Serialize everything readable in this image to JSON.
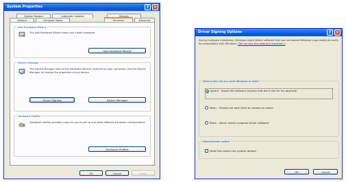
{
  "system_properties": {
    "title": "System Properties",
    "tabs_row1": [
      "System Restore",
      "Automatic Updates",
      "Remote"
    ],
    "tabs_row2": [
      "General",
      "Computer Name",
      "Hardware",
      "Advanced"
    ],
    "add_hardware": {
      "label": "Add Hardware Wizard",
      "text": "The Add Hardware Wizard helps you install hardware.",
      "button": "Add Hardware Wizard"
    },
    "device_manager": {
      "label": "Device Manager",
      "text": "The Device Manager lists all the hardware devices installed on your computer. Use the Device Manager to change the properties of any device.",
      "button_signing": "Driver Signing",
      "button_dm": "Device Manager"
    },
    "hardware_profiles": {
      "label": "Hardware Profiles",
      "text": "Hardware profiles provide a way for you to set up and store different hardware configurations.",
      "button": "Hardware Profiles"
    },
    "ok": "OK",
    "cancel": "Cancel",
    "apply": "Apply"
  },
  "driver_signing": {
    "title": "Driver Signing Options",
    "intro": "During hardware installation, Windows might detect software that has not passed Windows Logo testing to verify its compatibility with Windows.",
    "intro_link": "(Tell me why this testing is important.)",
    "question": "What action do you want Windows to take?",
    "options": [
      "Ignore - Install the software anyway and don't ask for my approval",
      "Warn - Prompt me each time to choose an action",
      "Block - Never install unsigned driver software"
    ],
    "admin_label": "Administrator option",
    "admin_checkbox": "Make this action the system default",
    "ok": "OK",
    "cancel": "Cancel"
  }
}
